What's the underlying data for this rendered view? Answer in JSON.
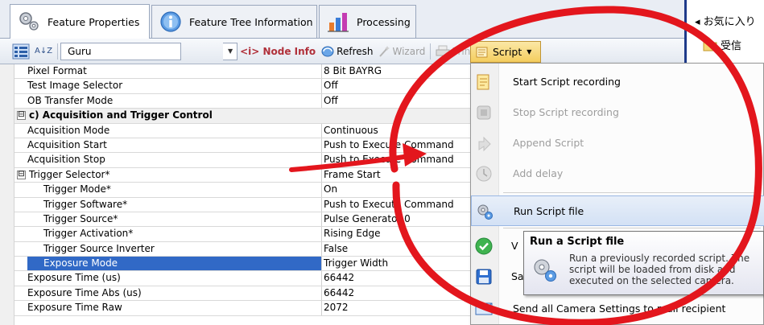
{
  "tabs": [
    {
      "label": "Feature Properties",
      "active": true
    },
    {
      "label": "Feature Tree Information",
      "active": false
    },
    {
      "label": "Processing",
      "active": false
    }
  ],
  "toolbar": {
    "sort_label": "A↓Z",
    "visibility_value": "Guru",
    "node_info_label": "<i> Node Info",
    "refresh_label": "Refresh",
    "wizard_label": "Wizard",
    "print_label": "Print",
    "script_label": "Script"
  },
  "grid": {
    "rows": [
      {
        "name": "Pixel Format",
        "value": "8 Bit BAYRG",
        "kind": "prop"
      },
      {
        "name": "Test Image Selector",
        "value": "Off",
        "kind": "prop"
      },
      {
        "name": "OB Transfer Mode",
        "value": "Off",
        "kind": "prop"
      },
      {
        "name": "c) Acquisition and Trigger Control",
        "value": "",
        "kind": "cat",
        "toggle": "⊟"
      },
      {
        "name": "Acquisition Mode",
        "value": "Continuous",
        "kind": "prop"
      },
      {
        "name": "Acquisition Start",
        "value": "Push to Execute Command",
        "kind": "prop"
      },
      {
        "name": "Acquisition Stop",
        "value": "Push to Execute Command",
        "kind": "prop"
      },
      {
        "name": "Trigger Selector*",
        "value": "Frame Start",
        "kind": "group",
        "toggle": "⊟"
      },
      {
        "name": "Trigger Mode*",
        "value": "On",
        "kind": "sub"
      },
      {
        "name": "Trigger Software*",
        "value": "Push to Execute Command",
        "kind": "sub"
      },
      {
        "name": "Trigger Source*",
        "value": "Pulse Generator 0",
        "kind": "sub"
      },
      {
        "name": "Trigger Activation*",
        "value": "Rising Edge",
        "kind": "sub"
      },
      {
        "name": "Trigger Source Inverter",
        "value": "False",
        "kind": "sub"
      },
      {
        "name": "Exposure Mode",
        "value": "Trigger Width",
        "kind": "sel"
      },
      {
        "name": "Exposure Time (us)",
        "value": "66442",
        "kind": "prop"
      },
      {
        "name": "Exposure Time Abs (us)",
        "value": "66442",
        "kind": "prop"
      },
      {
        "name": "Exposure Time Raw",
        "value": "2072",
        "kind": "prop"
      }
    ]
  },
  "menu": {
    "items": [
      {
        "label": "Start Script recording",
        "enabled": true,
        "icon": "scroll-icon"
      },
      {
        "label": "Stop Script recording",
        "enabled": false,
        "icon": "stop-icon"
      },
      {
        "label": "Append Script",
        "enabled": false,
        "icon": "append-icon"
      },
      {
        "label": "Add delay",
        "enabled": false,
        "icon": "clock-icon"
      },
      {
        "label": "Run Script file",
        "enabled": true,
        "icon": "gears-icon",
        "highlighted": true
      },
      {
        "label": "V",
        "enabled": true,
        "icon": "check-icon"
      },
      {
        "label": "Sa",
        "enabled": true,
        "icon": "save-icon"
      },
      {
        "label": "Send all Camera Settings to mail recipient",
        "enabled": true,
        "icon": "mail-icon"
      }
    ]
  },
  "tooltip": {
    "title": "Run a Script file",
    "body": "Run a previously recorded script. The script will be loaded from disk and executed on the selected camera."
  },
  "right_pane": {
    "favorites_label": "◂ お気に入り",
    "inbox_label": "受信"
  },
  "colors": {
    "selection": "#3169c6",
    "script_button": "#f4cd5e",
    "annotation": "#e3161d",
    "menu_hover": "#d3e1f5"
  }
}
